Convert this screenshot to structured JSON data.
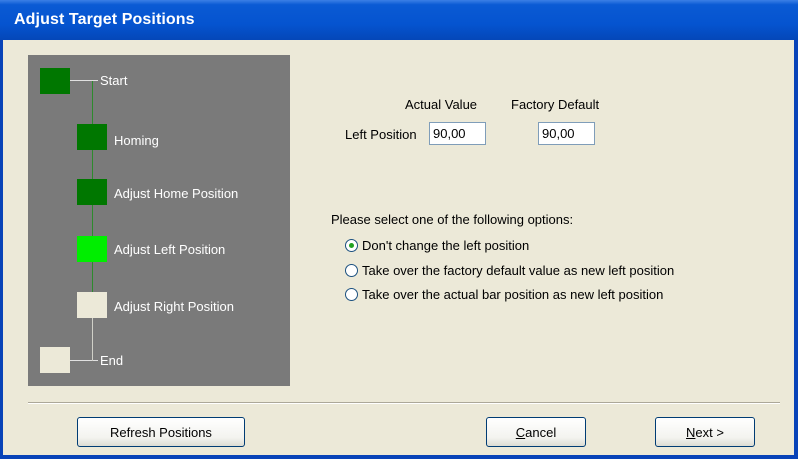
{
  "window": {
    "title": "Adjust Target Positions"
  },
  "steps": [
    {
      "label": "Start",
      "state": "done",
      "color": "#007700"
    },
    {
      "label": "Homing",
      "state": "done",
      "color": "#007700"
    },
    {
      "label": "Adjust Home Position",
      "state": "done",
      "color": "#007700"
    },
    {
      "label": "Adjust Left Position",
      "state": "current",
      "color": "#00ee00"
    },
    {
      "label": "Adjust Right Position",
      "state": "pending",
      "color": "#ece9d8"
    },
    {
      "label": "End",
      "state": "pending",
      "color": "#ece9d8"
    }
  ],
  "form": {
    "actual_value_header": "Actual Value",
    "factory_default_header": "Factory Default",
    "left_position_label": "Left Position",
    "actual_value": "90,00",
    "factory_default_value": "90,00"
  },
  "options": {
    "title": "Please select one of the following options:",
    "items": [
      {
        "label": "Don't change the left position",
        "checked": true
      },
      {
        "label": "Take over the factory default value as new left position",
        "checked": false
      },
      {
        "label": "Take over the actual bar position as new left position",
        "checked": false
      }
    ]
  },
  "buttons": {
    "refresh": "Refresh Positions",
    "cancel_mnemonic": "C",
    "cancel_rest": "ancel",
    "next_mnemonic": "N",
    "next_rest": "ext >"
  }
}
